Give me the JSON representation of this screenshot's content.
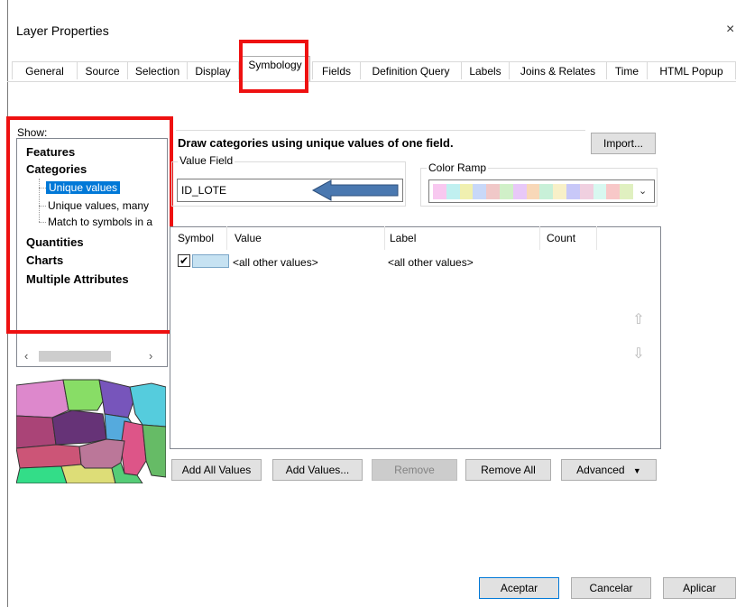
{
  "window": {
    "title": "Layer Properties",
    "close": "×"
  },
  "tabs": [
    "General",
    "Source",
    "Selection",
    "Display",
    "Symbology",
    "Fields",
    "Definition Query",
    "Labels",
    "Joins & Relates",
    "Time",
    "HTML Popup"
  ],
  "active_tab": "Symbology",
  "show": {
    "label": "Show:",
    "items": [
      {
        "label": "Features",
        "type": "category"
      },
      {
        "label": "Categories",
        "type": "category"
      },
      {
        "label": "Unique values",
        "type": "sub",
        "selected": true
      },
      {
        "label": "Unique values, many",
        "type": "sub"
      },
      {
        "label": "Match to symbols in a",
        "type": "sub"
      },
      {
        "label": "Quantities",
        "type": "category"
      },
      {
        "label": "Charts",
        "type": "category"
      },
      {
        "label": "Multiple Attributes",
        "type": "category"
      }
    ]
  },
  "main": {
    "heading": "Draw categories using unique values of one field.",
    "import_label": "Import...",
    "value_field_label": "Value Field",
    "value_field": "ID_LOTE",
    "color_ramp_label": "Color Ramp",
    "color_ramp_colors": [
      "#f8c8f0",
      "#c0f0f0",
      "#f0f0b0",
      "#c8d8f8",
      "#f0c8c8",
      "#d0f0c8",
      "#e8c8f8",
      "#f8d8b8",
      "#c8f0d8",
      "#f8f0c8",
      "#c8c8f8",
      "#f0d0e0",
      "#d8f8f0",
      "#f8c8c8",
      "#e0f0c0"
    ]
  },
  "table": {
    "columns": [
      "Symbol",
      "Value",
      "Label",
      "Count"
    ],
    "rows": [
      {
        "checked": true,
        "symbol_color": "#c6e2f2",
        "value": "<all other values>",
        "label": "<all other values>",
        "count": ""
      }
    ]
  },
  "buttons": {
    "add_all": "Add All Values",
    "add_values": "Add Values...",
    "remove": "Remove",
    "remove_all": "Remove All",
    "advanced": "Advanced"
  },
  "footer": {
    "ok": "Aceptar",
    "cancel": "Cancelar",
    "apply": "Aplicar"
  },
  "colors": {
    "highlight": "#ee1111",
    "selection": "#0078d7",
    "arrow": "#4a78b0"
  }
}
